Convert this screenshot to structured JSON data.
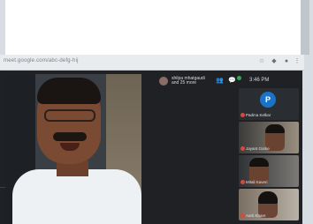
{
  "browser": {
    "url": "meet.google.com/abc-defg-hij"
  },
  "call": {
    "participant_names_line1": "shilpa mhatgaudi",
    "participant_names_line2": "and 25 more",
    "time": "3:46 PM",
    "participant_count_badge": "26"
  },
  "tiles": [
    {
      "name": "Padma Kelkar",
      "avatar_letter": "P",
      "kind": "avatar"
    },
    {
      "name": "Jayant Gorke",
      "kind": "video"
    },
    {
      "name": "Mitali Kaveri",
      "kind": "video"
    },
    {
      "name": "Aarti Khare",
      "kind": "video"
    }
  ],
  "colors": {
    "meet_background": "#1f2124",
    "avatar_blue": "#1a73c8",
    "muted_red": "#d14b3e"
  }
}
